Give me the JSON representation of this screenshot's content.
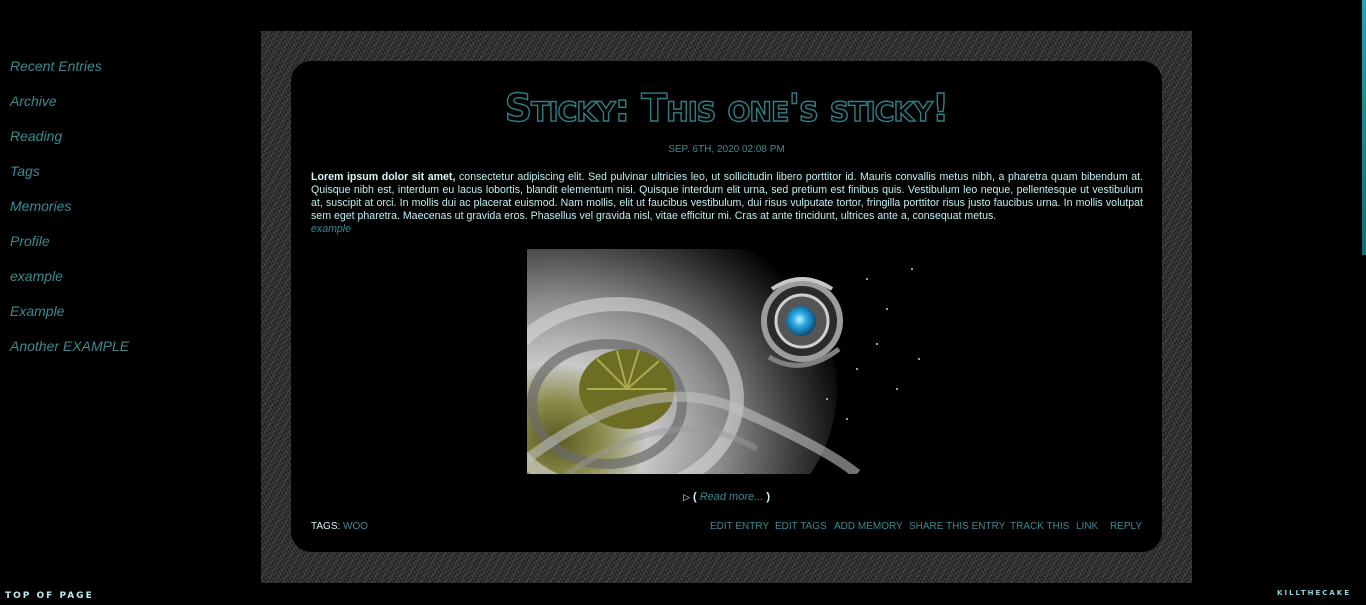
{
  "sidebar": {
    "items": [
      {
        "label": "Recent Entries"
      },
      {
        "label": "Archive"
      },
      {
        "label": "Reading"
      },
      {
        "label": "Tags"
      },
      {
        "label": "Memories"
      },
      {
        "label": "Profile"
      },
      {
        "label": "example"
      },
      {
        "label": "Example"
      },
      {
        "label": "Another EXAMPLE"
      }
    ]
  },
  "entry": {
    "title": "Sticky: This one's sticky!",
    "date": "SEP. 6TH, 2020 02:08 PM",
    "body_bold": "Lorem ipsum dolor sit amet,",
    "body_text": " consectetur adipiscing elit. Sed pulvinar ultricies leo, ut sollicitudin libero porttitor id. Mauris convallis metus nibh, a pharetra quam bibendum at. Quisque nibh est, interdum eu lacus lobortis, blandit elementum nisi. Quisque interdum elit urna, sed pretium est finibus quis. Vestibulum leo neque, pellentesque ut vestibulum at, suscipit at orci. In mollis dui ac placerat euismod. Nam mollis, elit ut faucibus vestibulum, dui risus vulputate tortor, fringilla porttitor risus justo faucibus urna. In mollis volutpat sem eget pharetra. Maecenas ut gravida eros. Phasellus vel gravida nisl, vitae efficitur mi. Cras at ante tincidunt, ultrices ante a, consequat metus.",
    "example_link": "example",
    "read_more": "Read more...",
    "read_more_open": "(",
    "read_more_close": ")",
    "tags_label": "TAGS:",
    "tag": "WOO",
    "actions": [
      {
        "label": "EDIT ENTRY"
      },
      {
        "label": "EDIT TAGS"
      },
      {
        "label": "ADD MEMORY"
      },
      {
        "label": "SHARE THIS ENTRY"
      },
      {
        "label": "TRACK THIS"
      },
      {
        "label": "LINK"
      },
      {
        "label": "REPLY"
      }
    ]
  },
  "footer": {
    "top_of_page": "TOP OF PAGE",
    "credit": "KILLTHECAKE"
  },
  "colors": {
    "accent": "#3d8a8e",
    "text": "#bfeff0",
    "background": "#000000"
  }
}
